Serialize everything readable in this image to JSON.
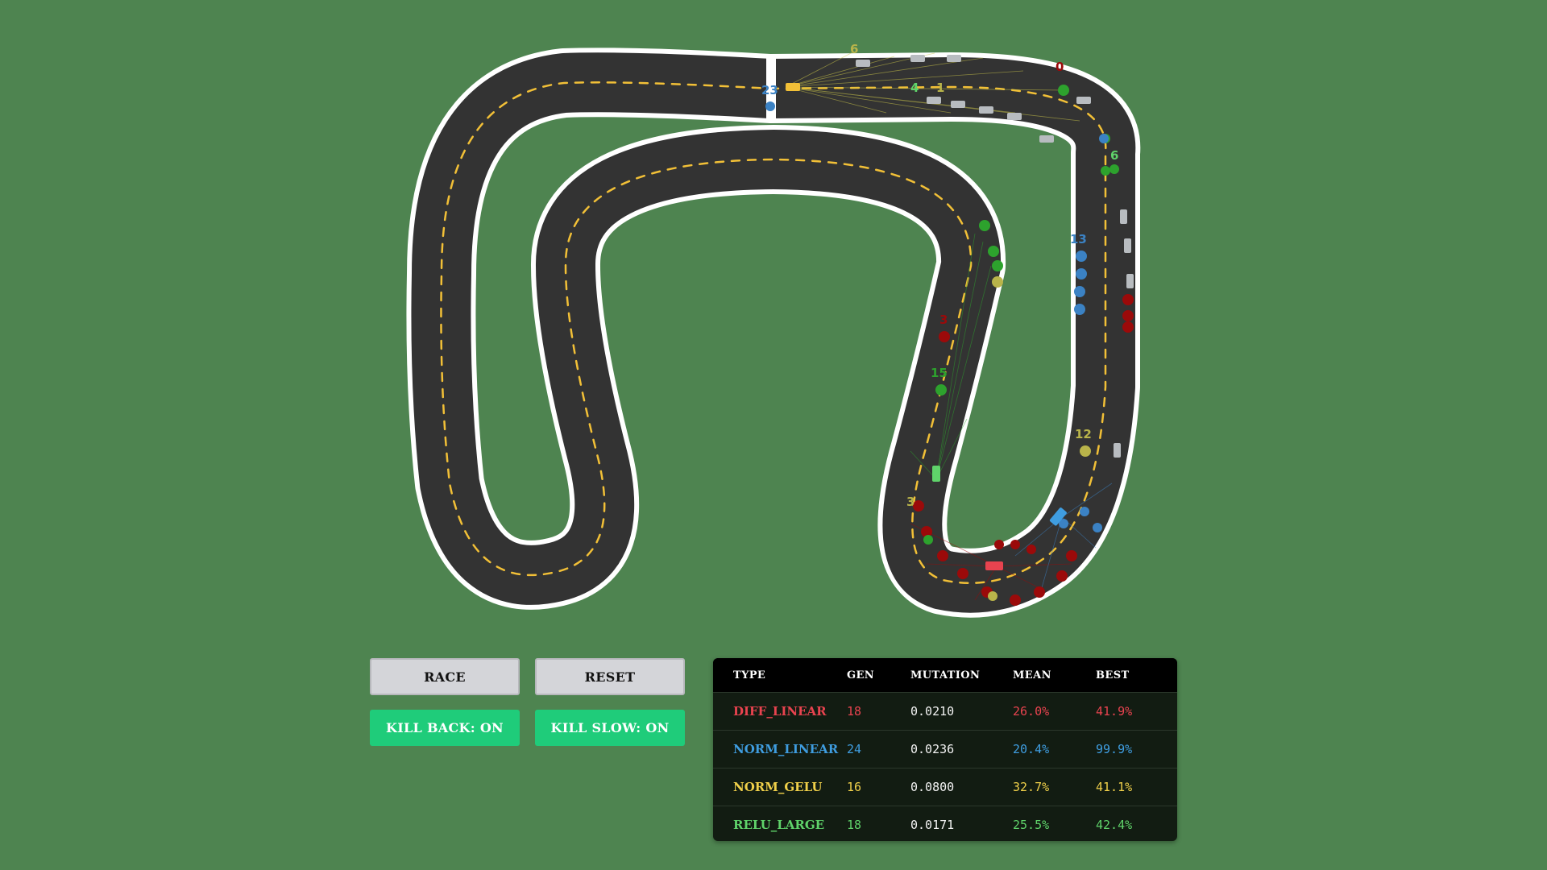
{
  "colors": {
    "background": "#4e8450",
    "road": "#333333",
    "edge": "#ffffff",
    "center_line": "#f2c037",
    "diff_linear": "#e8434f",
    "norm_linear": "#3f9de0",
    "norm_gelu": "#e8c94a",
    "relu_large": "#5fd36a"
  },
  "car_labels": [
    {
      "text": "6",
      "color": "#b9b44a"
    },
    {
      "text": "23",
      "color": "#3b82c4"
    },
    {
      "text": "4",
      "color": "#5fd36a"
    },
    {
      "text": "1",
      "color": "#b9b44a"
    },
    {
      "text": "0",
      "color": "#9b0a0a"
    },
    {
      "text": "6",
      "color": "#5fd36a"
    },
    {
      "text": "13",
      "color": "#3b82c4"
    },
    {
      "text": "3",
      "color": "#9b0a0a"
    },
    {
      "text": "15",
      "color": "#2da22d"
    },
    {
      "text": "12",
      "color": "#b9b44a"
    },
    {
      "text": "3",
      "color": "#b9b44a"
    }
  ],
  "controls": {
    "race": "RACE",
    "reset": "RESET",
    "kill_back": "KILL BACK: ON",
    "kill_slow": "KILL SLOW: ON"
  },
  "stats": {
    "headers": {
      "type": "TYPE",
      "gen": "GEN",
      "mutation": "MUTATION",
      "mean": "MEAN",
      "best": "BEST"
    },
    "rows": [
      {
        "type": "DIFF_LINEAR",
        "gen": "18",
        "mutation": "0.0210",
        "mean": "26.0%",
        "best": "41.9%",
        "color": "#e8434f"
      },
      {
        "type": "NORM_LINEAR",
        "gen": "24",
        "mutation": "0.0236",
        "mean": "20.4%",
        "best": "99.9%",
        "color": "#3f9de0"
      },
      {
        "type": "NORM_GELU",
        "gen": "16",
        "mutation": "0.0800",
        "mean": "32.7%",
        "best": "41.1%",
        "color": "#f0d04a"
      },
      {
        "type": "RELU_LARGE",
        "gen": "18",
        "mutation": "0.0171",
        "mean": "25.5%",
        "best": "42.4%",
        "color": "#5fd36a"
      }
    ]
  }
}
